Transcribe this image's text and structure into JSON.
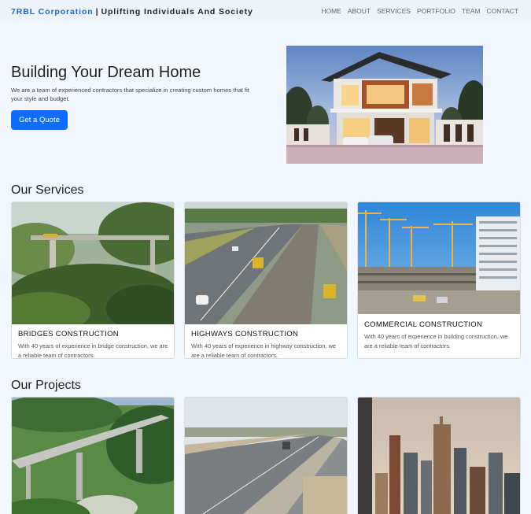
{
  "brand": {
    "name": "7RBL Corporation",
    "separator": "|",
    "tagline": "Uplifting Individuals And Society"
  },
  "nav": {
    "items": [
      "HOME",
      "ABOUT",
      "SERVICES",
      "PORTFOLIO",
      "TEAM",
      "CONTACT"
    ]
  },
  "hero": {
    "title": "Building Your Dream Home",
    "description": "We are a team of experienced contractors that specialize in creating custom homes that fit your style and budget.",
    "button": "Get a Quote",
    "image": "modern-two-storey-house-image"
  },
  "services": {
    "title": "Our Services",
    "cards": [
      {
        "title": "BRIDGES CONSTRUCTION",
        "text": "With 40 years of experience in bridge construction, we are a reliable team of contractors.",
        "image": "bridge-construction-image"
      },
      {
        "title": "HIGHWAYS CONSTRUCTION",
        "text": "With 40 years of experience in highway construction, we are a reliable team of contractors.",
        "image": "highway-construction-image"
      },
      {
        "title": "COMMERCIAL CONSTRUCTION",
        "text": "With 40 years of experience in building construction, we are a reliable team of contractors.",
        "image": "commercial-construction-image"
      }
    ]
  },
  "projects": {
    "title": "Our Projects",
    "cards": [
      {
        "image": "elevated-bridge-project-image"
      },
      {
        "image": "highway-project-image"
      },
      {
        "image": "city-skyline-project-image"
      }
    ]
  },
  "colors": {
    "accent": "#0d6efd",
    "brand": "#1b63d8",
    "background": "#f1f7fc"
  }
}
